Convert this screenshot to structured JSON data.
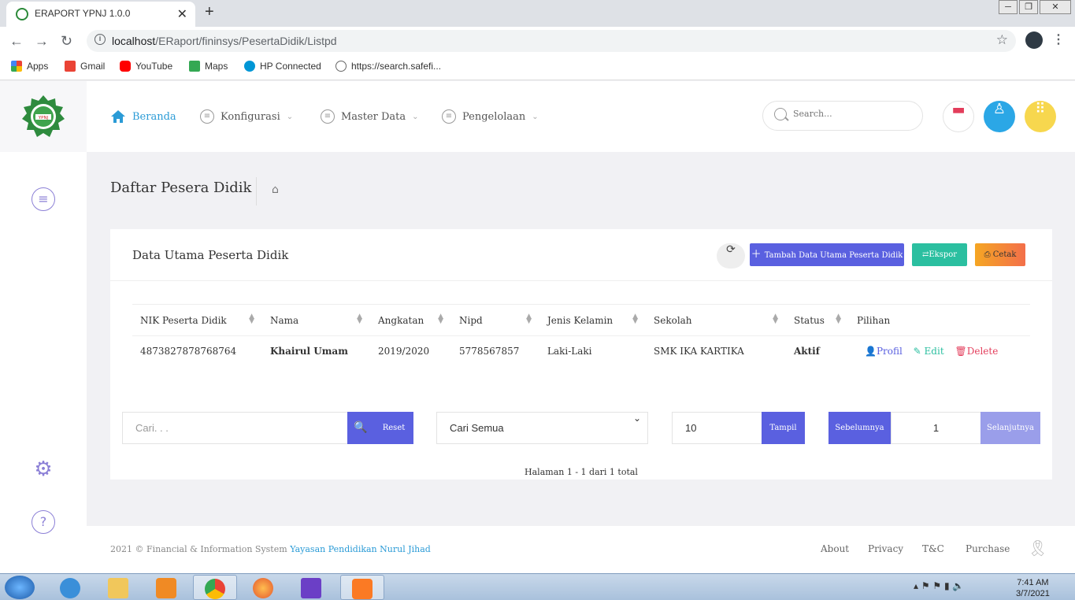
{
  "browser": {
    "tab_title": "ERAPORT YPNJ 1.0.0",
    "url_host": "localhost",
    "url_path": "/ERaport/fininsys/PesertaDidik/Listpd",
    "bookmarks": [
      "Apps",
      "Gmail",
      "YouTube",
      "Maps",
      "HP Connected",
      "https://search.safefi..."
    ]
  },
  "app": {
    "logo_text": "YPNJ",
    "nav": [
      {
        "label": "Beranda"
      },
      {
        "label": "Konfigurasi"
      },
      {
        "label": "Master Data"
      },
      {
        "label": "Pengelolaan"
      }
    ],
    "search_placeholder": "Search..."
  },
  "page": {
    "title": "Daftar Pesera Didik"
  },
  "card": {
    "title": "Data Utama Peserta Didik",
    "btn_add": "Tambah Data Utama Peserta Didik",
    "btn_export": "Ekspor",
    "btn_print": "Cetak"
  },
  "table": {
    "headers": [
      "NIK Peserta Didik",
      "Nama",
      "Angkatan",
      "Nipd",
      "Jenis Kelamin",
      "Sekolah",
      "Status",
      "Pilihan"
    ],
    "rows": [
      {
        "nik": "4873827878768764",
        "nama": "Khairul Umam",
        "angkatan": "2019/2020",
        "nipd": "5778567857",
        "jenis_kelamin": "Laki-Laki",
        "sekolah": "SMK IKA KARTIKA",
        "status": "Aktif",
        "actions": [
          "Profil",
          "Edit",
          "Delete"
        ]
      }
    ]
  },
  "controls": {
    "search_placeholder": "Cari. . .",
    "reset_label": "Reset",
    "filter_selected": "Cari Semua",
    "per_page": "10",
    "show_label": "Tampil",
    "prev_label": "Sebelumnya",
    "page_number": "1",
    "next_label": "Selanjutnya",
    "pager_info": "Halaman 1 - 1 dari 1 total"
  },
  "footer": {
    "copyright": "2021 © Financial & Information System",
    "org_link": "Yayasan Pendidikan Nurul Jihad",
    "links": [
      "About",
      "Privacy",
      "T&C",
      "Purchase"
    ]
  },
  "taskbar": {
    "time": "7:41 AM",
    "date": "3/7/2021"
  },
  "colors": {
    "primary": "#5a60e0",
    "accent": "#2b9bd6",
    "success": "#2bbfa0",
    "danger": "#e33d5b",
    "warning": "#f5a623"
  }
}
